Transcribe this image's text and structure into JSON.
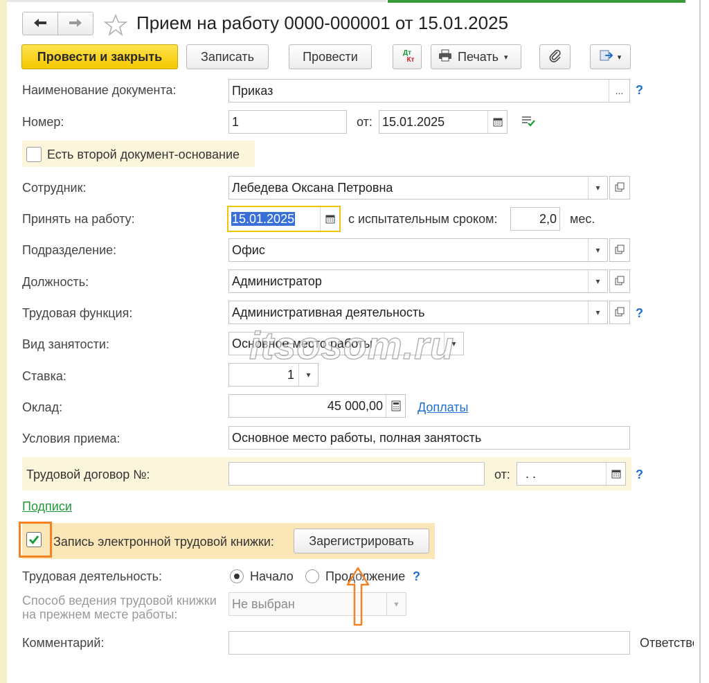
{
  "window": {
    "title": "Прием на работу 0000-000001 от 15.01.2025",
    "cut_right_label": "Ответстве"
  },
  "toolbar": {
    "post_close": "Провести и закрыть",
    "save": "Записать",
    "post": "Провести",
    "dtkt_top": "Дт",
    "dtkt_bottom": "Кт",
    "print": "Печать"
  },
  "form": {
    "doc_name_label": "Наименование документа:",
    "doc_name_value": "Приказ",
    "number_label": "Номер:",
    "number_value": "1",
    "from_label": "от:",
    "date_value": "15.01.2025",
    "second_doc_label": "Есть второй документ-основание",
    "employee_label": "Сотрудник:",
    "employee_value": "Лебедева Оксана Петровна",
    "hire_label": "Принять на работу:",
    "hire_date": "15.01.2025",
    "probation_label": "с испытательным сроком:",
    "probation_value": "2,0",
    "probation_unit": "мес.",
    "dept_label": "Подразделение:",
    "dept_value": "Офис",
    "position_label": "Должность:",
    "position_value": "Администратор",
    "labor_function_label": "Трудовая функция:",
    "labor_function_value": "Административная деятельность",
    "employment_type_label": "Вид занятости:",
    "employment_type_value": "Основное место работы",
    "rate_label": "Ставка:",
    "rate_value": "1",
    "salary_label": "Оклад:",
    "salary_value": "45 000,00",
    "allowances_link": "Доплаты",
    "conditions_label": "Условия приема:",
    "conditions_value": "Основное место работы, полная занятость",
    "contract_label": "Трудовой договор №:",
    "contract_value": "",
    "contract_from_label": "от:",
    "contract_date_value": ". .",
    "signatures_link": "Подписи",
    "etk_label": "Запись электронной трудовой книжки:",
    "register_button": "Зарегистрировать",
    "labor_activity_label": "Трудовая деятельность:",
    "radio_start": "Начало",
    "radio_continue": "Продолжение",
    "etk_method_label_1": "Способ ведения трудовой книжки",
    "etk_method_label_2": "на прежнем месте работы:",
    "etk_method_value": "Не выбран",
    "comment_label": "Комментарий:",
    "comment_value": "",
    "help_mark": "?"
  },
  "watermark": "itsosom.ru",
  "colors": {
    "primary_button": "#f5c800",
    "link": "#1f6fcf",
    "highlight_orange": "#f58220",
    "check_green": "#1a9a3a",
    "band_yellow": "#fbf5dc"
  }
}
